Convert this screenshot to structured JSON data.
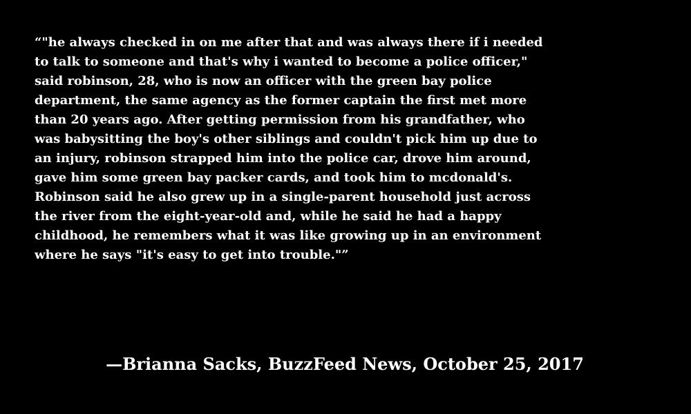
{
  "quote": {
    "text": "“\"he always checked in on me after that and was always there if i needed\nto talk to someone and that's why i wanted to become a police officer,\"\nsaid robinson, 28, who is now an officer with the green bay police\ndepartment, the same agency as the former captain the first met more\nthan 20 years ago. After getting permission from his grandfather, who\nwas babysitting the boy's other siblings and couldn't pick him up due to\nan injury, robinson strapped him into the police car, drove him around,\ngave him some green bay packer cards, and took him to mcdonald's.\nRobinson said he also grew up in a single-parent household just across\nthe river from the eight-year-old and, while he said he had a happy\nchildhood, he remembers what it was like growing up in an environment\nwhere he says \"it's easy to get into trouble.\"”"
  },
  "attribution": {
    "text": "—Brianna Sacks, BuzzFeed News, October 25, 2017"
  },
  "colors": {
    "background": "#000000",
    "text": "#ffffff"
  }
}
